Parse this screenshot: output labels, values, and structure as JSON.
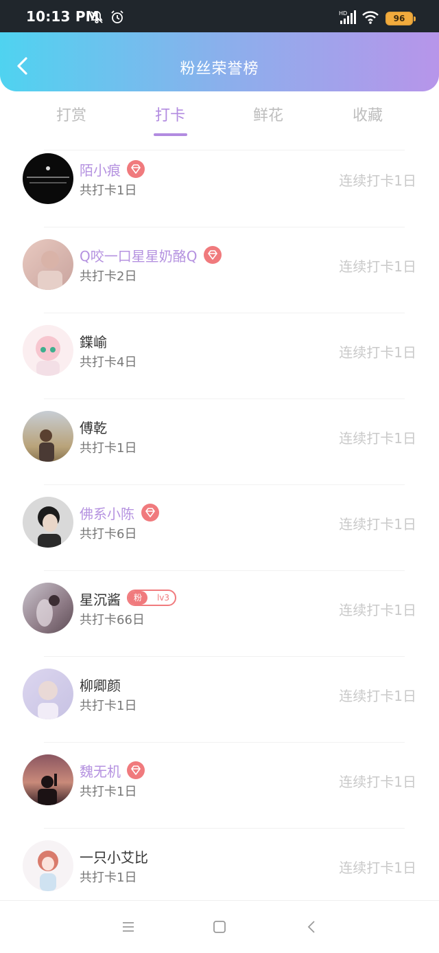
{
  "status_bar": {
    "time": "10:13 PM",
    "battery": "96",
    "icons": [
      "bell-off-icon",
      "alarm-icon",
      "signal-icon",
      "wifi-icon",
      "battery-icon"
    ]
  },
  "header": {
    "title": "粉丝荣誉榜",
    "back_icon": "back-arrow-icon",
    "gradient": [
      "#4fd3f0",
      "#b795ea"
    ]
  },
  "tabs": [
    {
      "label": "打赏",
      "active": false
    },
    {
      "label": "打卡",
      "active": true
    },
    {
      "label": "鲜花",
      "active": false
    },
    {
      "label": "收藏",
      "active": false
    }
  ],
  "colors": {
    "accent": "#b28be0",
    "vip_name": "#b592e0",
    "badge": "#f07a7d",
    "muted": "#c9c9c9"
  },
  "list": [
    {
      "name": "陌小痕",
      "vip": true,
      "badge": "gem-icon",
      "total": "共打卡1日",
      "streak": "连续打卡1日"
    },
    {
      "name": "Q咬一口星星奶酪Q",
      "vip": true,
      "badge": "gem-icon",
      "total": "共打卡2日",
      "streak": "连续打卡1日"
    },
    {
      "name": "鍱崳",
      "vip": false,
      "total": "共打卡4日",
      "streak": "连续打卡1日"
    },
    {
      "name": "傅乾",
      "vip": false,
      "total": "共打卡1日",
      "streak": "连续打卡1日"
    },
    {
      "name": "佛系小陈",
      "vip": true,
      "badge": "gem-icon",
      "total": "共打卡6日",
      "streak": "连续打卡1日"
    },
    {
      "name": "星沉酱",
      "vip": false,
      "fan_badge": {
        "label": "粉",
        "level": "lv3"
      },
      "total": "共打卡66日",
      "streak": "连续打卡1日"
    },
    {
      "name": "柳卿颜",
      "vip": false,
      "total": "共打卡1日",
      "streak": "连续打卡1日"
    },
    {
      "name": "魏无机",
      "vip": true,
      "badge": "gem-icon",
      "total": "共打卡1日",
      "streak": "连续打卡1日"
    },
    {
      "name": "一只小艾比",
      "vip": false,
      "total": "共打卡1日",
      "streak": "连续打卡1日"
    }
  ],
  "nav_bar": [
    "menu-icon",
    "home-icon",
    "back-icon"
  ]
}
